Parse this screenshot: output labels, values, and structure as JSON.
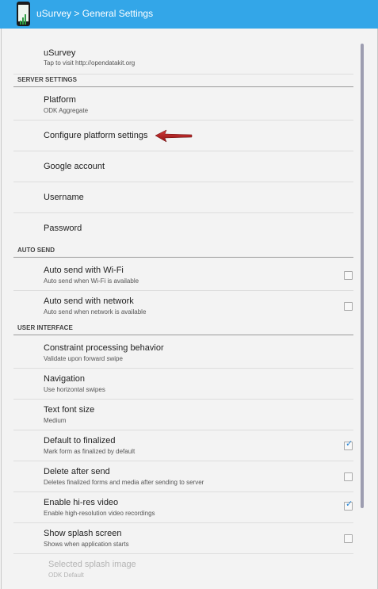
{
  "app": {
    "title": "uSurvey > General Settings"
  },
  "preferences": {
    "usurvey": {
      "title": "uSurvey",
      "summary": "Tap to visit http://opendatakit.org"
    },
    "server_category": "SERVER SETTINGS",
    "platform": {
      "title": "Platform",
      "summary": "ODK Aggregate"
    },
    "configure": {
      "title": "Configure platform settings"
    },
    "google": {
      "title": "Google account"
    },
    "username": {
      "title": "Username"
    },
    "password": {
      "title": "Password"
    },
    "autosend_category": "AUTO SEND",
    "wifi": {
      "title": "Auto send with Wi-Fi",
      "summary": "Auto send when Wi-Fi is available",
      "checked": false
    },
    "network": {
      "title": "Auto send with network",
      "summary": "Auto send when network is available",
      "checked": false
    },
    "ui_category": "USER INTERFACE",
    "constraint": {
      "title": "Constraint processing behavior",
      "summary": "Validate upon forward swipe"
    },
    "navigation": {
      "title": "Navigation",
      "summary": "Use horizontal swipes"
    },
    "font": {
      "title": "Text font size",
      "summary": "Medium"
    },
    "finalized": {
      "title": "Default to finalized",
      "summary": "Mark form as finalized by default",
      "checked": true
    },
    "delete": {
      "title": "Delete after send",
      "summary": "Deletes finalized forms and media after sending to server",
      "checked": false
    },
    "hires": {
      "title": "Enable hi-res video",
      "summary": "Enable high-resolution video recordings",
      "checked": true
    },
    "splash": {
      "title": "Show splash screen",
      "summary": "Shows when application starts",
      "checked": false
    },
    "splash_image": {
      "title": "Selected splash image",
      "summary": "ODK Default"
    }
  },
  "colors": {
    "action_bar": "#33a6e8",
    "check": "#2a87d6",
    "arrow": "#b31b1b"
  }
}
